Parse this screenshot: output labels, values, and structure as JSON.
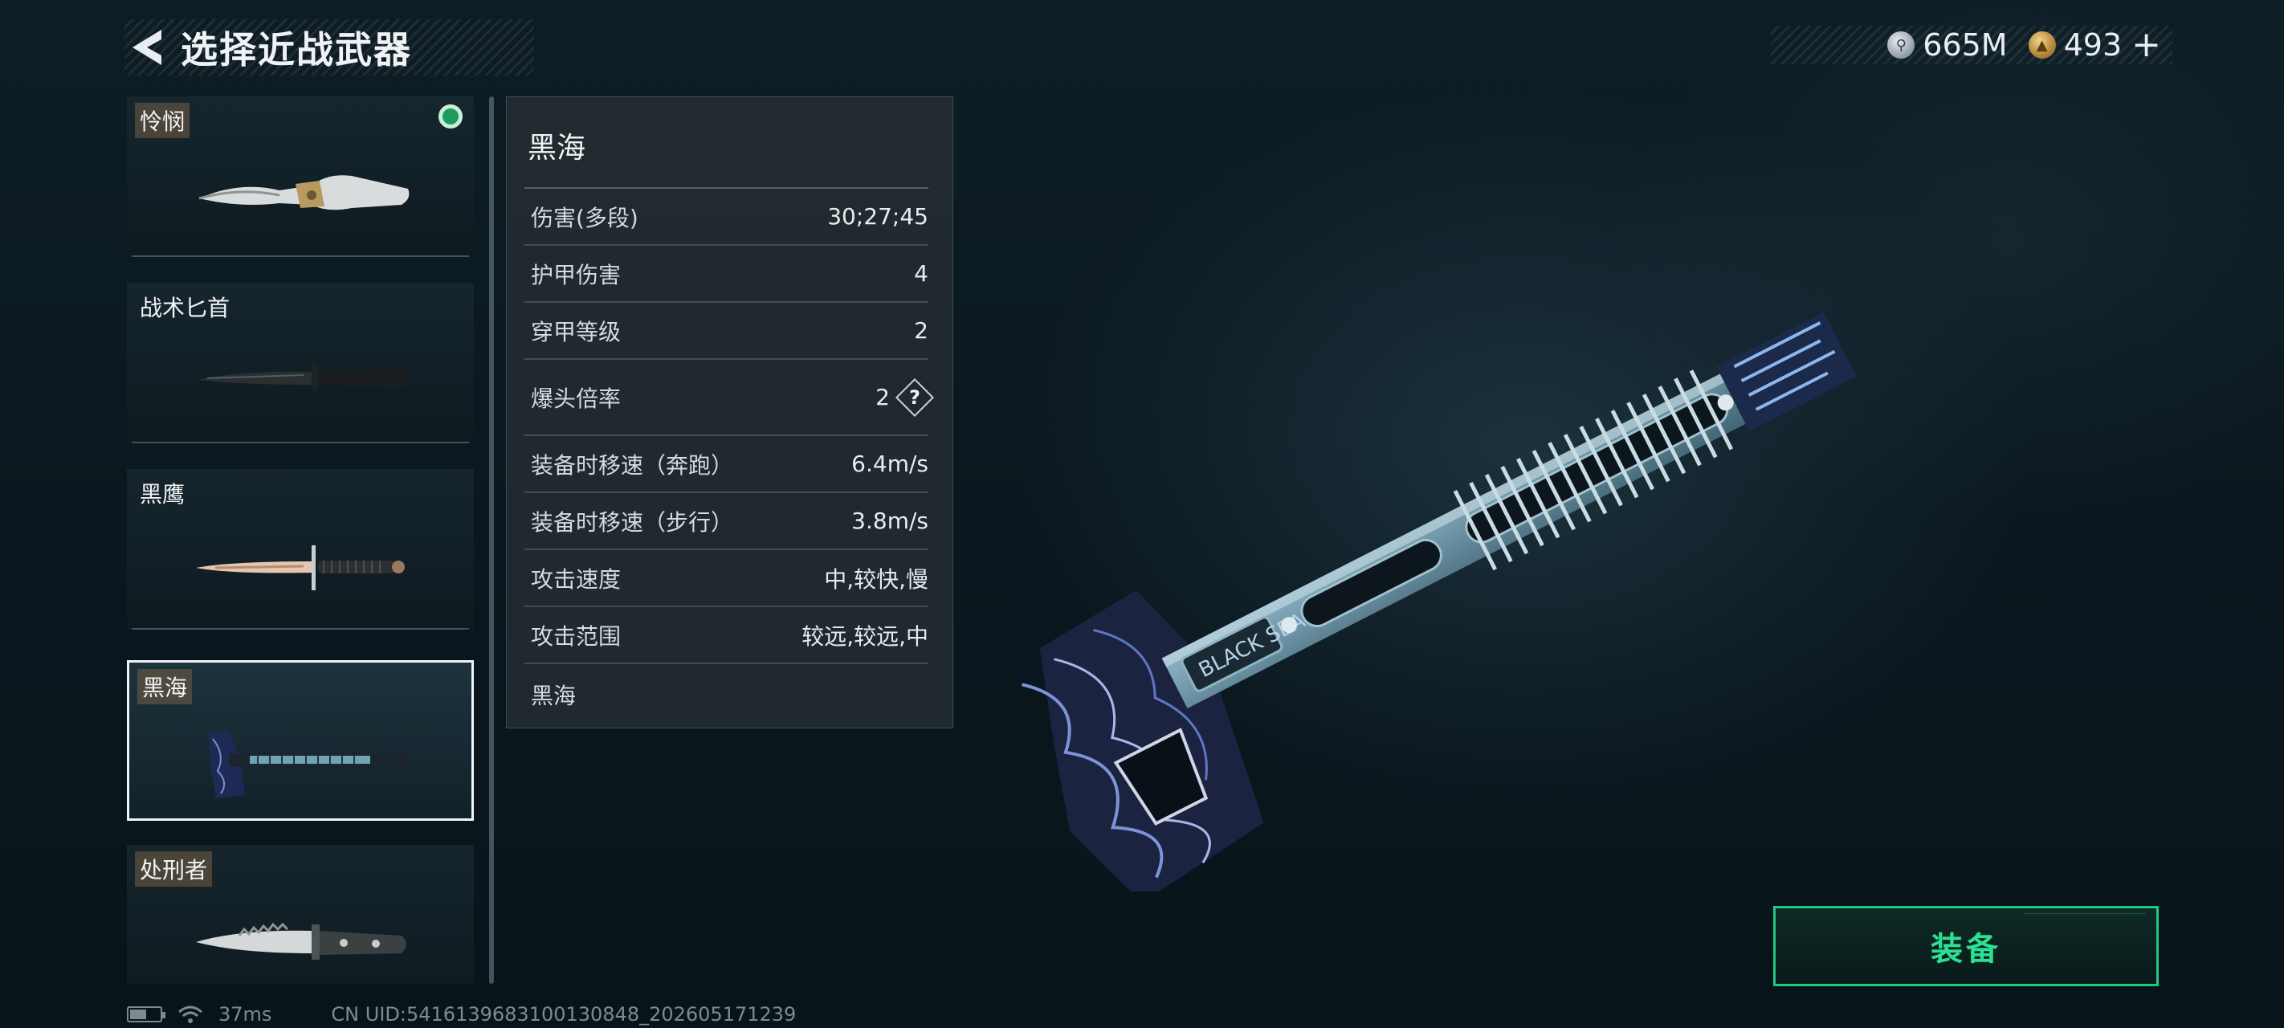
{
  "header": {
    "title": "选择近战武器"
  },
  "currency": [
    {
      "icon": "silver-coin-icon",
      "value": "665M"
    },
    {
      "icon": "gold-coin-icon",
      "value": "493",
      "plus": "+"
    }
  ],
  "weapons": [
    {
      "name": "怜悯",
      "tag": true,
      "equipped": true
    },
    {
      "name": "战术匕首",
      "tag": false
    },
    {
      "name": "黑鹰",
      "tag": false
    },
    {
      "name": "黑海",
      "tag": true,
      "selected": true
    },
    {
      "name": "处刑者",
      "tag": true
    }
  ],
  "detail": {
    "title": "黑海",
    "stats": [
      {
        "label": "伤害(多段)",
        "value": "30;27;45"
      },
      {
        "label": "护甲伤害",
        "value": "4"
      },
      {
        "label": "穿甲等级",
        "value": "2"
      },
      {
        "label": "爆头倍率",
        "value": "2",
        "help": "?"
      },
      {
        "label": "装备时移速（奔跑）",
        "value": "6.4m/s"
      },
      {
        "label": "装备时移速（步行）",
        "value": "3.8m/s"
      },
      {
        "label": "攻击速度",
        "value": "中,较快,慢"
      },
      {
        "label": "攻击范围",
        "value": "较远,较远,中"
      }
    ],
    "description": "黑海"
  },
  "weapon_render_label": "BLACK SEA",
  "equip_button": "装备",
  "status": {
    "ping": "37ms",
    "uid": "CN UID:5416139683100130848_202605171239"
  },
  "colors": {
    "accent_green": "#2be191",
    "equipped_dot": "#1d9c62"
  }
}
